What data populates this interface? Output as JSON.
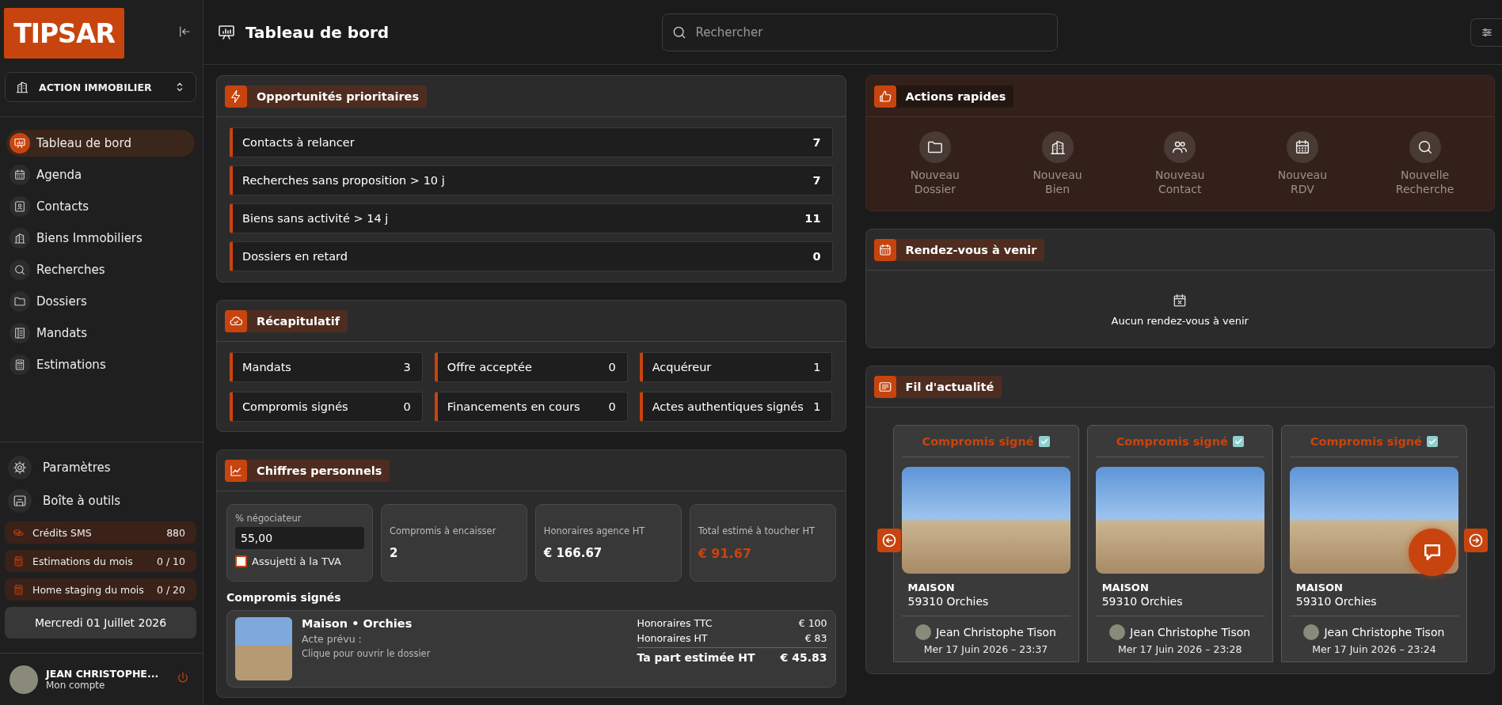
{
  "sidebar": {
    "logo": "TIPSAR",
    "agency": "ACTION IMMOBILIER",
    "nav": [
      {
        "label": "Tableau de bord",
        "selected": true
      },
      {
        "label": "Agenda",
        "selected": false
      },
      {
        "label": "Contacts",
        "selected": false
      },
      {
        "label": "Biens Immobiliers",
        "selected": false
      },
      {
        "label": "Recherches",
        "selected": false
      },
      {
        "label": "Dossiers",
        "selected": false
      },
      {
        "label": "Mandats",
        "selected": false
      },
      {
        "label": "Estimations",
        "selected": false
      }
    ],
    "links": [
      {
        "label": "Paramètres"
      },
      {
        "label": "Boîte à outils"
      }
    ],
    "counters": [
      {
        "label": "Crédits SMS",
        "value": "880"
      },
      {
        "label": "Estimations du mois",
        "value": "0 / 10"
      },
      {
        "label": "Home staging du mois",
        "value": "0 / 20"
      }
    ],
    "date": "Mercredi 01 Juillet 2026",
    "user": {
      "name": "JEAN CHRISTOPHE...",
      "subtitle": "Mon compte"
    }
  },
  "header": {
    "title": "Tableau de bord",
    "search": {
      "placeholder": "Rechercher"
    }
  },
  "opportunities": {
    "title": "Opportunités prioritaires",
    "items": [
      {
        "label": "Contacts à relancer",
        "count": "7"
      },
      {
        "label": "Recherches sans proposition > 10 j",
        "count": "7"
      },
      {
        "label": "Biens sans activité > 14 j",
        "count": "11"
      },
      {
        "label": "Dossiers en retard",
        "count": "0"
      }
    ]
  },
  "summary": {
    "title": "Récapitulatif",
    "items": [
      {
        "label": "Mandats",
        "count": "3"
      },
      {
        "label": "Offre acceptée",
        "count": "0"
      },
      {
        "label": "Acquéreur",
        "count": "1"
      },
      {
        "label": "Compromis signés",
        "count": "0"
      },
      {
        "label": "Financements en cours",
        "count": "0"
      },
      {
        "label": "Actes authentiques signés",
        "count": "1"
      }
    ]
  },
  "personal_figures": {
    "title": "Chiffres personnels",
    "negotiator": {
      "label": "% négociateur",
      "value": "55,00"
    },
    "vat": {
      "label": "Assujetti à la TVA",
      "checked": false
    },
    "stats": [
      {
        "label": "Compromis à encaisser",
        "value": "2",
        "highlight": false
      },
      {
        "label": "Honoraires agence HT",
        "value": "€ 166.67",
        "highlight": false
      },
      {
        "label": "Total estimé à toucher HT",
        "value": "€ 91.67",
        "highlight": true
      }
    ],
    "signed_title": "Compromis signés",
    "signed": [
      {
        "title": "Maison • Orchies",
        "act": "Acte prévu :",
        "hint": "Clique pour ouvrir le dossier",
        "fees": [
          {
            "label": "Honoraires TTC",
            "value": "€ 100"
          },
          {
            "label": "Honoraires HT",
            "value": "€ 83"
          }
        ],
        "share": {
          "label": "Ta part estimée HT",
          "value": "€ 45.83"
        }
      }
    ]
  },
  "quick_actions": {
    "title": "Actions rapides",
    "actions": [
      {
        "label": "Nouveau Dossier"
      },
      {
        "label": "Nouveau Bien"
      },
      {
        "label": "Nouveau Contact"
      },
      {
        "label": "Nouveau RDV"
      },
      {
        "label": "Nouvelle Recherche"
      }
    ]
  },
  "appointments": {
    "title": "Rendez-vous à venir",
    "empty": "Aucun rendez-vous à venir"
  },
  "news_feed": {
    "title": "Fil d'actualité",
    "cards": [
      {
        "status": "Compromis signé",
        "type": "MAISON",
        "location": "59310 Orchies",
        "author": "Jean Christophe Tison",
        "date": "Mer 17 Juin 2026 – 23:37"
      },
      {
        "status": "Compromis signé",
        "type": "MAISON",
        "location": "59310 Orchies",
        "author": "Jean Christophe Tison",
        "date": "Mer 17 Juin 2026 – 23:28"
      },
      {
        "status": "Compromis signé",
        "type": "MAISON",
        "location": "59310 Orchies",
        "author": "Jean Christophe Tison",
        "date": "Mer 17 Juin 2026 – 23:24"
      }
    ]
  }
}
